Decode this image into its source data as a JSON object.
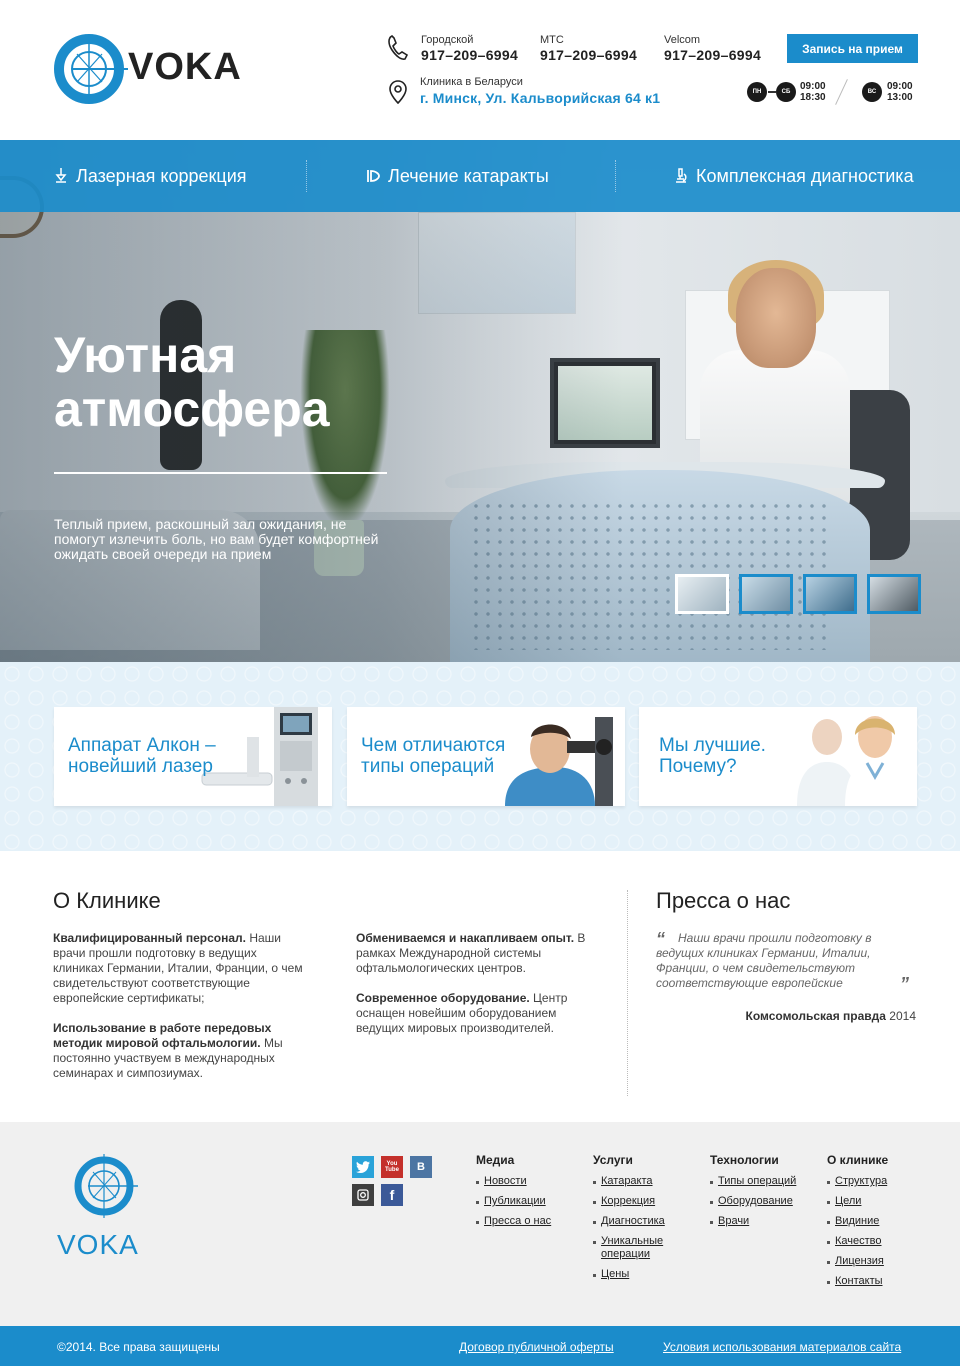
{
  "header": {
    "logo_text": "VOKA",
    "phones": [
      {
        "label": "Городской",
        "number": "917–209–6994"
      },
      {
        "label": "МТС",
        "number": "917–209–6994"
      },
      {
        "label": "Velcom",
        "number": "917–209–6994"
      }
    ],
    "address_label": "Клиника в Беларуси",
    "address_value": "г. Минск, Ул. Кальворийская 64 к1",
    "cta_label": "Запись на прием",
    "schedule": {
      "weekday_from": "ПН",
      "weekday_to": "СБ",
      "weekday_open": "09:00",
      "weekday_close": "18:30",
      "sunday": "ВС",
      "sunday_open": "09:00",
      "sunday_close": "13:00"
    }
  },
  "nav": {
    "items": [
      {
        "label": "Лазерная коррекция",
        "icon": "laser-icon"
      },
      {
        "label": "Лечение катаракты",
        "icon": "eye-lens-icon"
      },
      {
        "label": "Комплексная диагностика",
        "icon": "microscope-icon"
      }
    ]
  },
  "hero": {
    "title": "Уютная атмосфера",
    "description": "Теплый прием, раскошный зал ожидания, не помогут излечить боль, но вам будет комфортней ожидать своей очереди на прием",
    "thumbnails": 4,
    "active_thumbnail": 1
  },
  "features": [
    {
      "title": "Аппарат Алкон – новейший лазер"
    },
    {
      "title": "Чем отличаются типы операций"
    },
    {
      "title": "Мы лучшие. Почему?"
    }
  ],
  "about": {
    "title": "О Клинике",
    "p1_bold": "Квалифицированный персонал.",
    "p1_text": " Наши врачи прошли подготовку в ведущих клиниках Германии, Италии, Франции, о чем свидетельствуют соответствующие европейские сертификаты;",
    "p2_bold": "Использование в работе передовых методик мировой офтальмологии.",
    "p2_text": " Мы постоянно участвуем в международных семинарах и симпозиумах.",
    "p3_bold": "Обмениваемся и накапливаем опыт.",
    "p3_text": " В рамках Международной системы офтальмологических центров.",
    "p4_bold": "Современное оборудование.",
    "p4_text": " Центр оснащен новейшим оборудованием ведущих мировых производителей."
  },
  "press": {
    "title": "Пресса о нас",
    "quote": "Наши врачи прошли подготовку в ведущих клиниках Германии, Италии, Франции, о чем свидетельствуют соответствующие европейские",
    "source": "Комсомольская правда",
    "year": "2014"
  },
  "footer": {
    "logo_text": "VOKA",
    "social": [
      {
        "name": "twitter-icon",
        "glyph": "t",
        "color": "#2aa3d9"
      },
      {
        "name": "youtube-icon",
        "glyph": "You\nTube",
        "color": "#c4302b"
      },
      {
        "name": "vk-icon",
        "glyph": "B",
        "color": "#4c75a3"
      },
      {
        "name": "instagram-icon",
        "glyph": "◎",
        "color": "#3f3f3f"
      },
      {
        "name": "facebook-icon",
        "glyph": "f",
        "color": "#3b5998"
      }
    ],
    "columns": [
      {
        "title": "Медиа",
        "links": [
          "Новости",
          "Публикации",
          "Пресса о нас"
        ]
      },
      {
        "title": "Услуги",
        "links": [
          "Катаракта",
          "Коррекция",
          "Диагностика",
          "Уникальные операции",
          "Цены"
        ]
      },
      {
        "title": "Технологии",
        "links": [
          "Типы операций",
          "Оборудование",
          "Врачи"
        ]
      },
      {
        "title": "О клинике",
        "links": [
          "Структура",
          "Цели",
          "Видиние",
          "Качество",
          "Лицензия",
          "Контакты"
        ]
      }
    ],
    "copyright": "©2014. Все права защищены",
    "link_offer": "Договор публичной оферты",
    "link_terms": "Условия использования материалов сайта"
  },
  "colors": {
    "accent": "#1b8ccb",
    "footer_bg": "#f0f0f0",
    "strip_bg": "#e4f1f9"
  }
}
